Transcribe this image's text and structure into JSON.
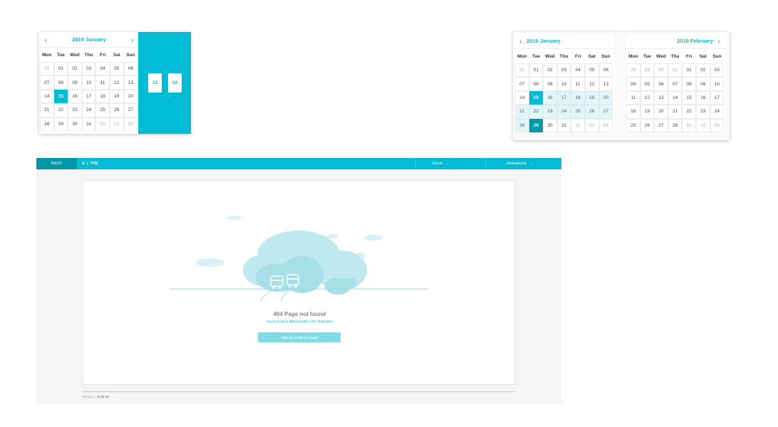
{
  "weekdays": [
    "Mon",
    "Tue",
    "Wed",
    "Thu",
    "Fri",
    "Sat",
    "Sun"
  ],
  "picker1": {
    "month_title": "2019 January",
    "prev_icon": "‹",
    "next_icon": "›",
    "days": [
      [
        "31",
        "01",
        "02",
        "03",
        "04",
        "05",
        "06"
      ],
      [
        "07",
        "08",
        "09",
        "10",
        "11",
        "12",
        "13"
      ],
      [
        "14",
        "15",
        "16",
        "17",
        "18",
        "19",
        "20"
      ],
      [
        "21",
        "22",
        "23",
        "24",
        "25",
        "26",
        "27"
      ],
      [
        "28",
        "29",
        "30",
        "31",
        "01",
        "02",
        "03"
      ]
    ],
    "selected_day": "15",
    "time": {
      "hour": "12",
      "minute": "54"
    }
  },
  "picker2": {
    "left": {
      "month_title": "2019 January",
      "prev_icon": "‹",
      "days": [
        [
          "31",
          "01",
          "02",
          "03",
          "04",
          "05",
          "06"
        ],
        [
          "07",
          "08",
          "09",
          "10",
          "11",
          "12",
          "13"
        ],
        [
          "14",
          "15",
          "16",
          "17",
          "18",
          "19",
          "20"
        ],
        [
          "21",
          "22",
          "23",
          "24",
          "25",
          "26",
          "27"
        ],
        [
          "28",
          "29",
          "30",
          "31",
          "01",
          "02",
          "03"
        ]
      ]
    },
    "right": {
      "month_title": "2019 February",
      "next_icon": "›",
      "days": [
        [
          "28",
          "29",
          "30",
          "31",
          "01",
          "02",
          "03"
        ],
        [
          "04",
          "05",
          "06",
          "07",
          "08",
          "09",
          "10"
        ],
        [
          "11",
          "12",
          "13",
          "14",
          "15",
          "16",
          "17"
        ],
        [
          "18",
          "19",
          "20",
          "21",
          "22",
          "23",
          "24"
        ],
        [
          "25",
          "26",
          "27",
          "28",
          "01",
          "02",
          "03"
        ]
      ]
    },
    "range_start": "15",
    "range_end": "29"
  },
  "app": {
    "back_label": "BACK",
    "brand_logo": "A",
    "brand_sep": "|",
    "brand_name": "THE",
    "dropdown_location": "Ekerö",
    "dropdown_user": "Aleksandra",
    "chevron_icon": "⌄",
    "not_found_title": "404 Page not found",
    "not_found_subtitle": "You must find a different path to the destination",
    "cta_label": "Take me to list of events",
    "footer_version": "Version",
    "footer_sep": "|",
    "footer_build": "Build 39"
  },
  "colors": {
    "accent": "#00bcd4",
    "accent_dark": "#0097a7",
    "range_fill": "#e2f6f8",
    "cta": "#7fdbe6"
  }
}
